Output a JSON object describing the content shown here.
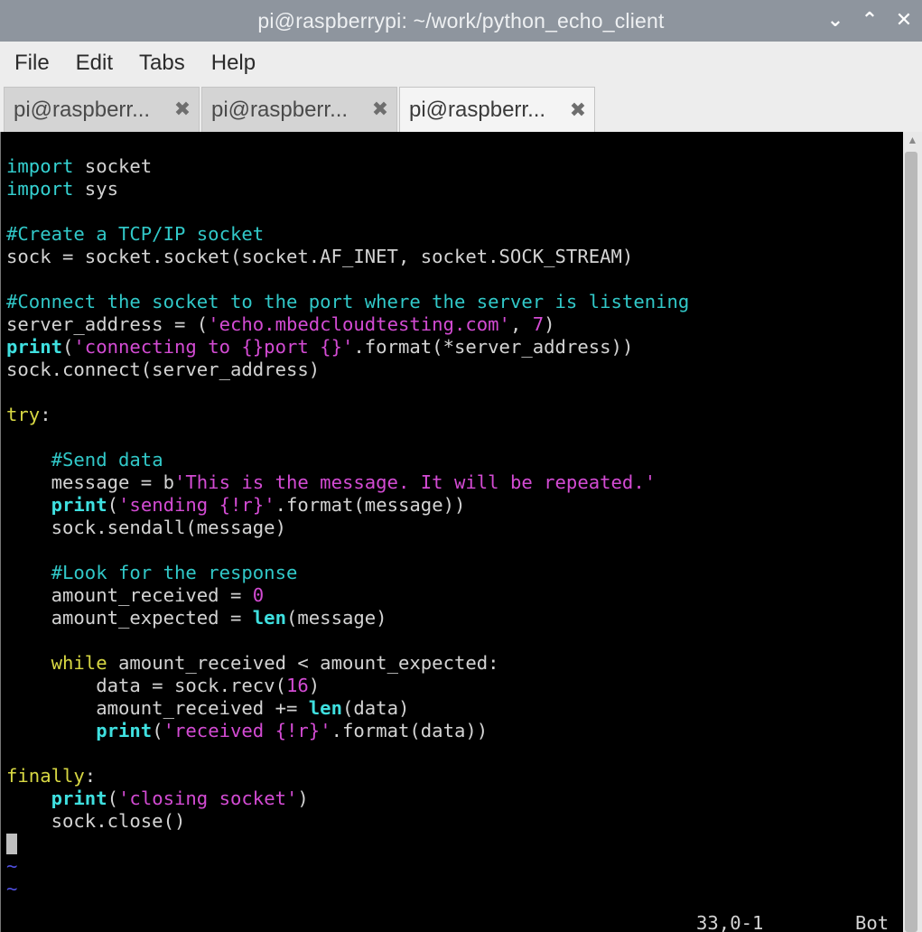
{
  "window": {
    "title": "pi@raspberrypi: ~/work/python_echo_client",
    "controls": {
      "minimize": "⌄",
      "maximize": "⌃",
      "close": "✕"
    }
  },
  "menu": [
    "File",
    "Edit",
    "Tabs",
    "Help"
  ],
  "tabs": [
    {
      "label": "pi@raspberr...",
      "active": false
    },
    {
      "label": "pi@raspberr...",
      "active": false
    },
    {
      "label": "pi@raspberr...",
      "active": true
    }
  ],
  "editor": {
    "lines": [
      [
        [
          "import",
          "kw"
        ],
        [
          " socket",
          ""
        ]
      ],
      [
        [
          "import",
          "kw"
        ],
        [
          " sys",
          ""
        ]
      ],
      [],
      [
        [
          "#Create a TCP/IP socket",
          "cm"
        ]
      ],
      [
        [
          "sock = socket.socket(socket.AF_INET, socket.SOCK_STREAM)",
          ""
        ]
      ],
      [],
      [
        [
          "#Connect the socket to the port where the server is listening",
          "cm"
        ]
      ],
      [
        [
          "server_address = (",
          ""
        ],
        [
          "'echo.mbedcloudtesting.com'",
          "st"
        ],
        [
          ", ",
          ""
        ],
        [
          "7",
          "num"
        ],
        [
          ")",
          ""
        ]
      ],
      [
        [
          "print",
          "kwb"
        ],
        [
          "(",
          ""
        ],
        [
          "'connecting to {}port {}'",
          "st"
        ],
        [
          ".format(*server_address))",
          ""
        ]
      ],
      [
        [
          "sock.connect(server_address)",
          ""
        ]
      ],
      [],
      [
        [
          "try",
          "ctl"
        ],
        [
          ":",
          ""
        ]
      ],
      [],
      [
        [
          "    ",
          ""
        ],
        [
          "#Send data",
          "cm"
        ]
      ],
      [
        [
          "    message = b",
          ""
        ],
        [
          "'This is the message. It will be repeated.'",
          "st"
        ]
      ],
      [
        [
          "    ",
          ""
        ],
        [
          "print",
          "kwb"
        ],
        [
          "(",
          ""
        ],
        [
          "'sending {!r}'",
          "st"
        ],
        [
          ".format(message))",
          ""
        ]
      ],
      [
        [
          "    sock.sendall(message)",
          ""
        ]
      ],
      [],
      [
        [
          "    ",
          ""
        ],
        [
          "#Look for the response",
          "cm"
        ]
      ],
      [
        [
          "    amount_received = ",
          ""
        ],
        [
          "0",
          "num"
        ]
      ],
      [
        [
          "    amount_expected = ",
          ""
        ],
        [
          "len",
          "kwb"
        ],
        [
          "(message)",
          ""
        ]
      ],
      [],
      [
        [
          "    ",
          ""
        ],
        [
          "while",
          "ctl"
        ],
        [
          " amount_received < amount_expected:",
          ""
        ]
      ],
      [
        [
          "        data = sock.recv(",
          ""
        ],
        [
          "16",
          "num"
        ],
        [
          ")",
          ""
        ]
      ],
      [
        [
          "        amount_received += ",
          ""
        ],
        [
          "len",
          "kwb"
        ],
        [
          "(data)",
          ""
        ]
      ],
      [
        [
          "        ",
          ""
        ],
        [
          "print",
          "kwb"
        ],
        [
          "(",
          ""
        ],
        [
          "'received {!r}'",
          "st"
        ],
        [
          ".format(data))",
          ""
        ]
      ],
      [],
      [
        [
          "finally",
          "ctl"
        ],
        [
          ":",
          ""
        ]
      ],
      [
        [
          "    ",
          ""
        ],
        [
          "print",
          "kwb"
        ],
        [
          "(",
          ""
        ],
        [
          "'closing socket'",
          "st"
        ],
        [
          ")",
          ""
        ]
      ],
      [
        [
          "    sock.close()",
          ""
        ]
      ],
      [
        [
          "",
          "cursor"
        ]
      ],
      [
        [
          "~",
          "tilde"
        ]
      ],
      [
        [
          "~",
          "tilde"
        ]
      ]
    ],
    "status": {
      "position": "33,0-1",
      "scroll": "Bot"
    }
  }
}
